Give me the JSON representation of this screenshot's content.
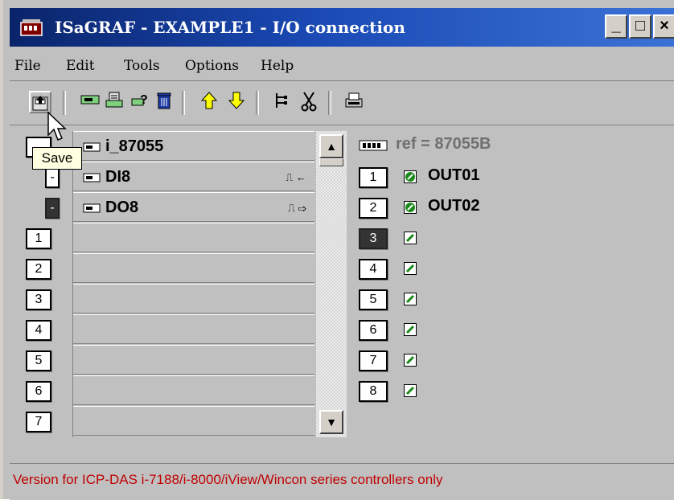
{
  "window": {
    "title": "ISaGRAF - EXAMPLE1 - I/O connection",
    "controls": [
      "_",
      "□",
      "×"
    ]
  },
  "menu": [
    "File",
    "Edit",
    "Tools",
    "Options",
    "Help"
  ],
  "toolbar": {
    "tooltip": "Save",
    "icons": [
      "save-icon",
      "connect-icon",
      "set-icon",
      "help-icon",
      "delete-icon",
      "up-icon",
      "down-icon",
      "tree-icon",
      "cut-icon",
      "print-icon"
    ]
  },
  "board": {
    "name": "i_87055",
    "rows": [
      {
        "label": "DI8",
        "signal": "⎍ ←"
      },
      {
        "label": "DO8",
        "signal": "⎍ ⇨"
      }
    ],
    "slots": [
      "1",
      "2",
      "3",
      "4",
      "5",
      "6",
      "7"
    ]
  },
  "channels": {
    "ref": "ref = 87055B",
    "items": [
      {
        "n": "1",
        "name": "OUT01"
      },
      {
        "n": "2",
        "name": "OUT02"
      },
      {
        "n": "3",
        "name": ""
      },
      {
        "n": "4",
        "name": ""
      },
      {
        "n": "5",
        "name": ""
      },
      {
        "n": "6",
        "name": ""
      },
      {
        "n": "7",
        "name": ""
      },
      {
        "n": "8",
        "name": ""
      }
    ]
  },
  "status": "Version for ICP-DAS i-7188/i-8000/iView/Wincon series controllers only",
  "colors": {
    "title_bg": "#0a246a",
    "status_text": "#c00000",
    "window_bg": "#c0c0c0"
  }
}
